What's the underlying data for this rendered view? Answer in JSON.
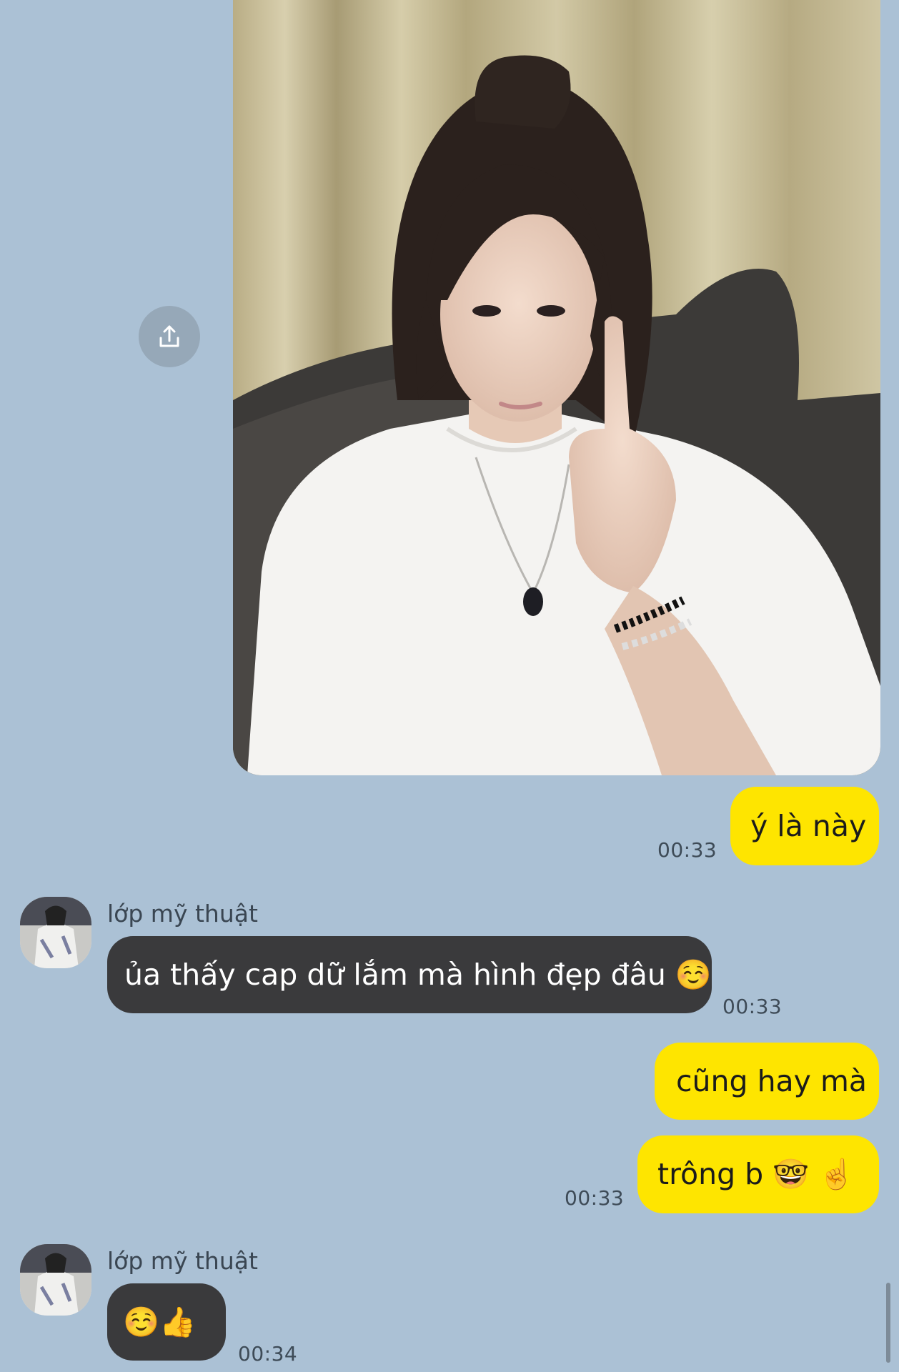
{
  "image_message": {
    "photo_description_icon": "shared-photo",
    "share_icon": "share-upload-icon"
  },
  "messages": [
    {
      "id": "m1",
      "direction": "outgoing",
      "text": "ý là này",
      "time": "00:33"
    },
    {
      "id": "m2",
      "direction": "incoming",
      "sender": "lớp mỹ thuật",
      "text": "ủa thấy cap dữ lắm mà hình đẹp đâu ☺️",
      "time": "00:33"
    },
    {
      "id": "m3",
      "direction": "outgoing",
      "text": "cũng hay mà"
    },
    {
      "id": "m4",
      "direction": "outgoing",
      "text": "trông b 🤓 ☝️",
      "time": "00:33"
    },
    {
      "id": "m5",
      "direction": "incoming",
      "sender": "lớp mỹ thuật",
      "text": "☺️👍",
      "time": "00:34"
    }
  ],
  "colors": {
    "background": "#abc1d5",
    "outgoing_bubble": "#fee500",
    "incoming_bubble": "#3a3a3c"
  }
}
